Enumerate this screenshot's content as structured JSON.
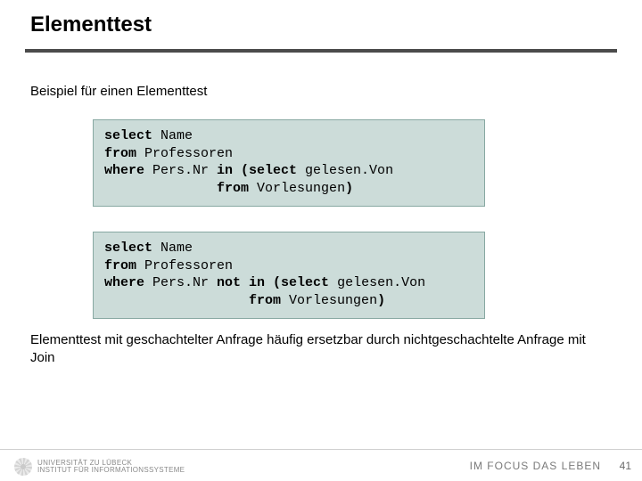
{
  "title": "Elementtest",
  "subtitle": "Beispiel für einen Elementtest",
  "code1": {
    "l1a": "select",
    "l1b": " Name",
    "l2a": "from",
    "l2b": " Professoren",
    "l3a": "where",
    "l3b": " Pers.Nr ",
    "l3c": "in (select",
    "l3d": " gelesen.Von",
    "l4a": "              ",
    "l4b": "from",
    "l4c": " Vorlesungen",
    "l4d": ")"
  },
  "code2": {
    "l1a": "select",
    "l1b": " Name",
    "l2a": "from",
    "l2b": " Professoren",
    "l3a": "where",
    "l3b": " Pers.Nr ",
    "l3c": "not in (select",
    "l3d": " gelesen.Von",
    "l4a": "                  ",
    "l4b": "from",
    "l4c": " Vorlesungen",
    "l4d": ")"
  },
  "bodytext": "Elementtest mit geschachtelter Anfrage häufig ersetzbar durch nichtgeschachtelte Anfrage mit Join",
  "footer": {
    "uni_line1": "UNIVERSITÄT ZU LÜBECK",
    "uni_line2": "INSTITUT FÜR INFORMATIONSSYSTEME",
    "motto": "IM FOCUS DAS LEBEN",
    "page": "41"
  }
}
